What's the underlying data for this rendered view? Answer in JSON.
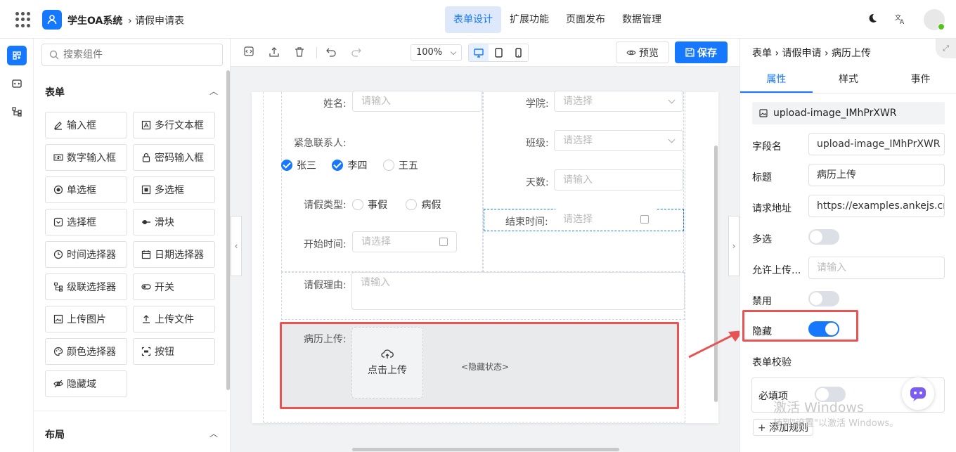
{
  "app": {
    "title": "学生OA系统",
    "breadcrumb": "请假申请表"
  },
  "nav": {
    "items": [
      "表单设计",
      "扩展功能",
      "页面发布",
      "数据管理"
    ],
    "active": 0
  },
  "components": {
    "search_placeholder": "搜索组件",
    "form_section": "表单",
    "items": [
      {
        "label": "输入框",
        "icon": "pencil-icon"
      },
      {
        "label": "多行文本框",
        "icon": "textarea-icon"
      },
      {
        "label": "数字输入框",
        "icon": "number-icon"
      },
      {
        "label": "密码输入框",
        "icon": "lock-icon"
      },
      {
        "label": "单选框",
        "icon": "radio-icon"
      },
      {
        "label": "多选框",
        "icon": "checkbox-icon"
      },
      {
        "label": "选择框",
        "icon": "select-icon"
      },
      {
        "label": "滑块",
        "icon": "slider-icon"
      },
      {
        "label": "时间选择器",
        "icon": "clock-icon"
      },
      {
        "label": "日期选择器",
        "icon": "calendar-icon"
      },
      {
        "label": "级联选择器",
        "icon": "cascader-icon"
      },
      {
        "label": "开关",
        "icon": "switch-icon"
      },
      {
        "label": "上传图片",
        "icon": "image-icon"
      },
      {
        "label": "上传文件",
        "icon": "upload-icon"
      },
      {
        "label": "颜色选择器",
        "icon": "palette-icon"
      },
      {
        "label": "按钮",
        "icon": "button-icon"
      },
      {
        "label": "隐藏域",
        "icon": "eye-off-icon"
      }
    ],
    "layout_section": "布局"
  },
  "toolbar": {
    "zoom": "100%",
    "preview": "预览",
    "save": "保存"
  },
  "form": {
    "name_label": "姓名:",
    "name_ph": "请输入",
    "college_label": "学院:",
    "college_ph": "请选择",
    "contact_label": "紧急联系人:",
    "contacts": [
      {
        "label": "张三",
        "checked": true
      },
      {
        "label": "李四",
        "checked": true
      },
      {
        "label": "王五",
        "checked": false
      }
    ],
    "class_label": "班级:",
    "class_ph": "请选择",
    "days_label": "天数:",
    "days_ph": "请输入",
    "type_label": "请假类型:",
    "types": [
      "事假",
      "病假"
    ],
    "end_label": "结束时间:",
    "end_ph": "请选择",
    "start_label": "开始时间:",
    "start_ph": "请选择",
    "reason_label": "请假理由:",
    "reason_ph": "请输入",
    "upload_label": "病历上传:",
    "upload_text": "点击上传",
    "hidden_state": "<隐藏状态>"
  },
  "props": {
    "breadcrumb": [
      "表单",
      "请假申请",
      "病历上传"
    ],
    "tabs": [
      "属性",
      "样式",
      "事件"
    ],
    "id": "upload-image_IMhPrXWR",
    "field_label": "字段名",
    "field_value": "upload-image_IMhPrXWR",
    "title_label": "标题",
    "title_value": "病历上传",
    "url_label": "请求地址",
    "url_value": "https://examples.ankejs.cn/a",
    "multi_label": "多选",
    "allow_label": "允许上传...",
    "allow_ph": "请输入",
    "disabled_label": "禁用",
    "hidden_label": "隐藏",
    "validation_label": "表单校验",
    "required_label": "必填项",
    "add_rule": "+ 添加规则"
  },
  "switches": {
    "multi": false,
    "disabled": false,
    "hidden": true,
    "required": false
  },
  "watermark": {
    "line1": "激活 Windows",
    "line2": "转到\"设置\"以激活 Windows。"
  },
  "colors": {
    "accent": "#1677ff",
    "highlight": "#e85454"
  }
}
